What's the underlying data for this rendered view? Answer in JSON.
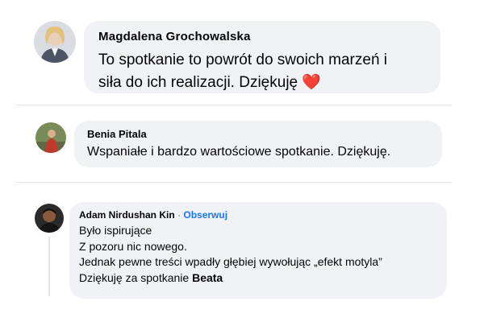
{
  "comments": [
    {
      "author": "Magdalena Grochowalska",
      "lines": [
        "To spotkanie to powrót do swoich marzeń i",
        "siła do ich realizacji. Dziękuję"
      ],
      "emoji": "❤️"
    },
    {
      "author": "Benia Pitala",
      "lines": [
        "Wspaniałe i bardzo wartościowe spotkanie. Dziękuję."
      ]
    },
    {
      "author": "Adam Nirdushan Kin",
      "separator": "·",
      "follow_label": "Obserwuj",
      "lines": [
        "Było ispirujące",
        "Z pozoru nic nowego.",
        "Jednak pewne treści wpadły głębiej wywołując „efekt motyla”",
        "Dziękuję za spotkanie"
      ],
      "mention": "Beata"
    }
  ],
  "colors": {
    "bubble": "#f0f2f5",
    "link": "#1877f2",
    "text": "#050505",
    "heart": "#e0245e"
  },
  "icons": {
    "heart": "red-heart-icon"
  }
}
